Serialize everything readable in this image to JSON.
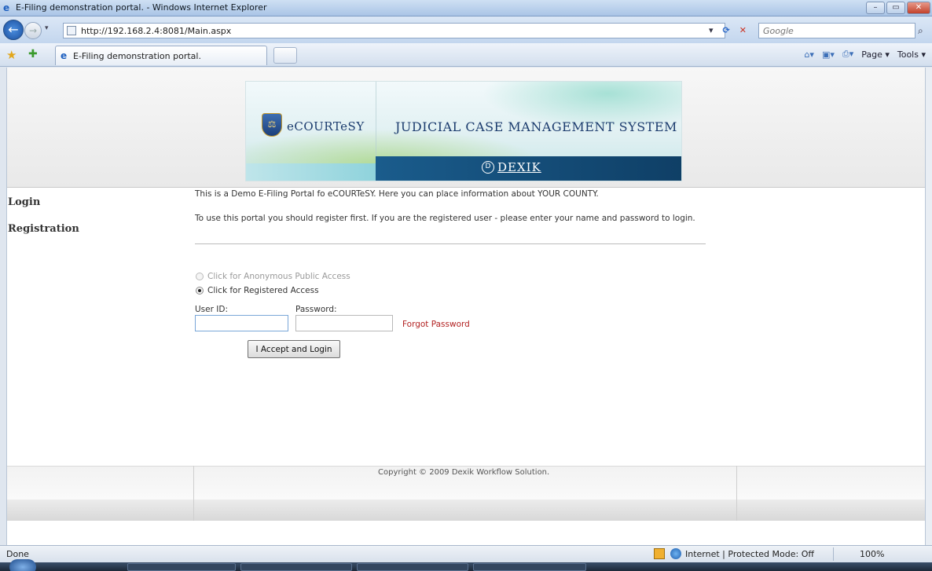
{
  "window": {
    "title": "E-Filing demonstration portal. - Windows Internet Explorer",
    "buttons": [
      "–",
      "▭",
      "✕"
    ]
  },
  "address_bar": {
    "url": "http://192.168.2.4:8081/Main.aspx",
    "search_placeholder": "Google"
  },
  "command_bar": {
    "tab_title": "E-Filing demonstration portal.",
    "page_menu": "Page ▾",
    "tools_menu": "Tools ▾"
  },
  "banner": {
    "brand": "eCOURTeSY",
    "system": "JUDICIAL CASE MANAGEMENT SYSTEM",
    "company": "DEXIK"
  },
  "sidebar": {
    "items": [
      {
        "label": "Login"
      },
      {
        "label": "Registration"
      }
    ]
  },
  "main": {
    "intro": "This is a Demo E-Filing Portal fo eCOURTeSY. Here you can place information about YOUR COUNTY.",
    "instructions": "To use this portal you should register first. If you are the registered user - please enter your name and password to login.",
    "access_options": [
      {
        "label": "Click for Anonymous Public Access",
        "selected": false,
        "enabled": false
      },
      {
        "label": "Click for Registered Access",
        "selected": true,
        "enabled": true
      }
    ],
    "user_id_label": "User ID:",
    "password_label": "Password:",
    "user_id_value": "",
    "password_value": "",
    "forgot_password": "Forgot Password",
    "login_button": "I Accept and Login"
  },
  "footer": {
    "copyright": "Copyright © 2009 Dexik Workflow Solution."
  },
  "status_bar": {
    "status": "Done",
    "zone": "Internet | Protected Mode: Off",
    "zoom": "100%"
  }
}
